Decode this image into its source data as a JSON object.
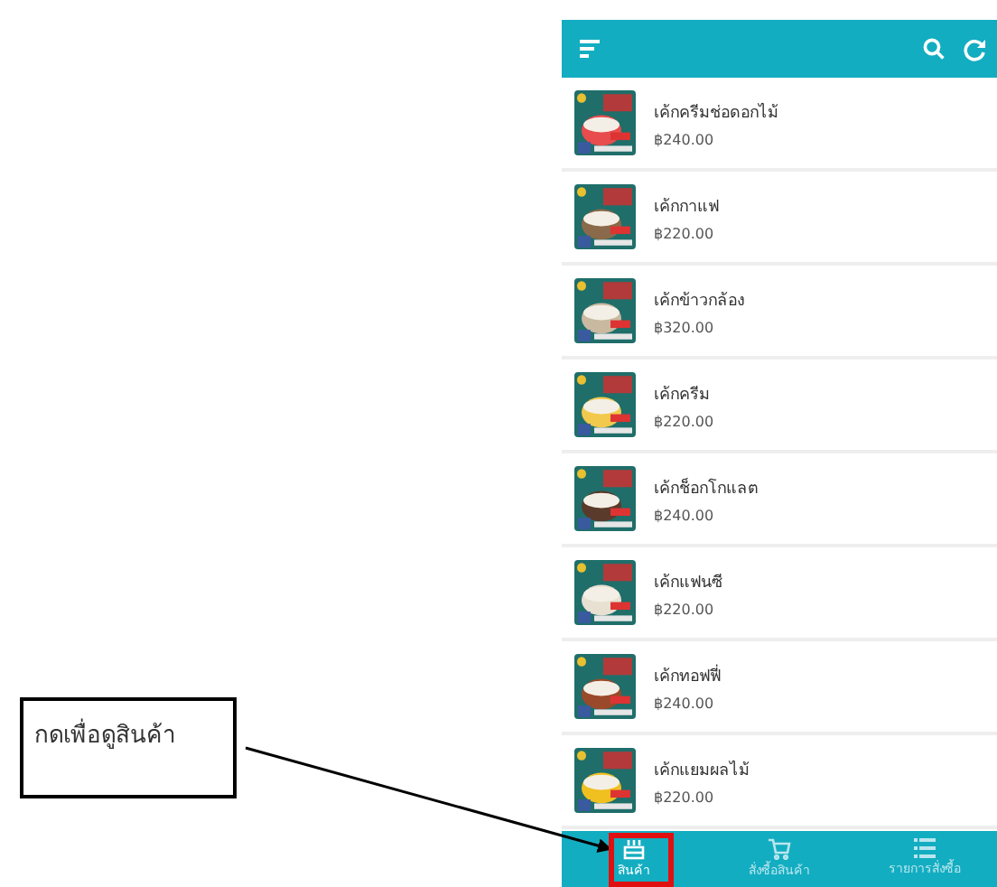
{
  "products": [
    {
      "name": "เค้กครีมช่อดอกไม้",
      "price": "฿240.00"
    },
    {
      "name": "เค้กกาแฟ",
      "price": "฿220.00"
    },
    {
      "name": "เค้กข้าวกล้อง",
      "price": "฿320.00"
    },
    {
      "name": "เค้กครีม",
      "price": "฿220.00"
    },
    {
      "name": "เค้กช็อกโกแลต",
      "price": "฿240.00"
    },
    {
      "name": "เค้กแฟนซี",
      "price": "฿220.00"
    },
    {
      "name": "เค้กทอฟฟี่",
      "price": "฿240.00"
    },
    {
      "name": "เค้กแยมผลไม้",
      "price": "฿220.00"
    }
  ],
  "bottom_nav": [
    {
      "kind": "cake",
      "label": "สินค้า",
      "selected": true
    },
    {
      "kind": "cart",
      "label": "สั่งซื้อสินค้า",
      "selected": false
    },
    {
      "kind": "list",
      "label": "รายการสั่งซื้อ",
      "selected": false
    }
  ],
  "callout": {
    "text": "กดเพื่อดูสินค้า"
  }
}
